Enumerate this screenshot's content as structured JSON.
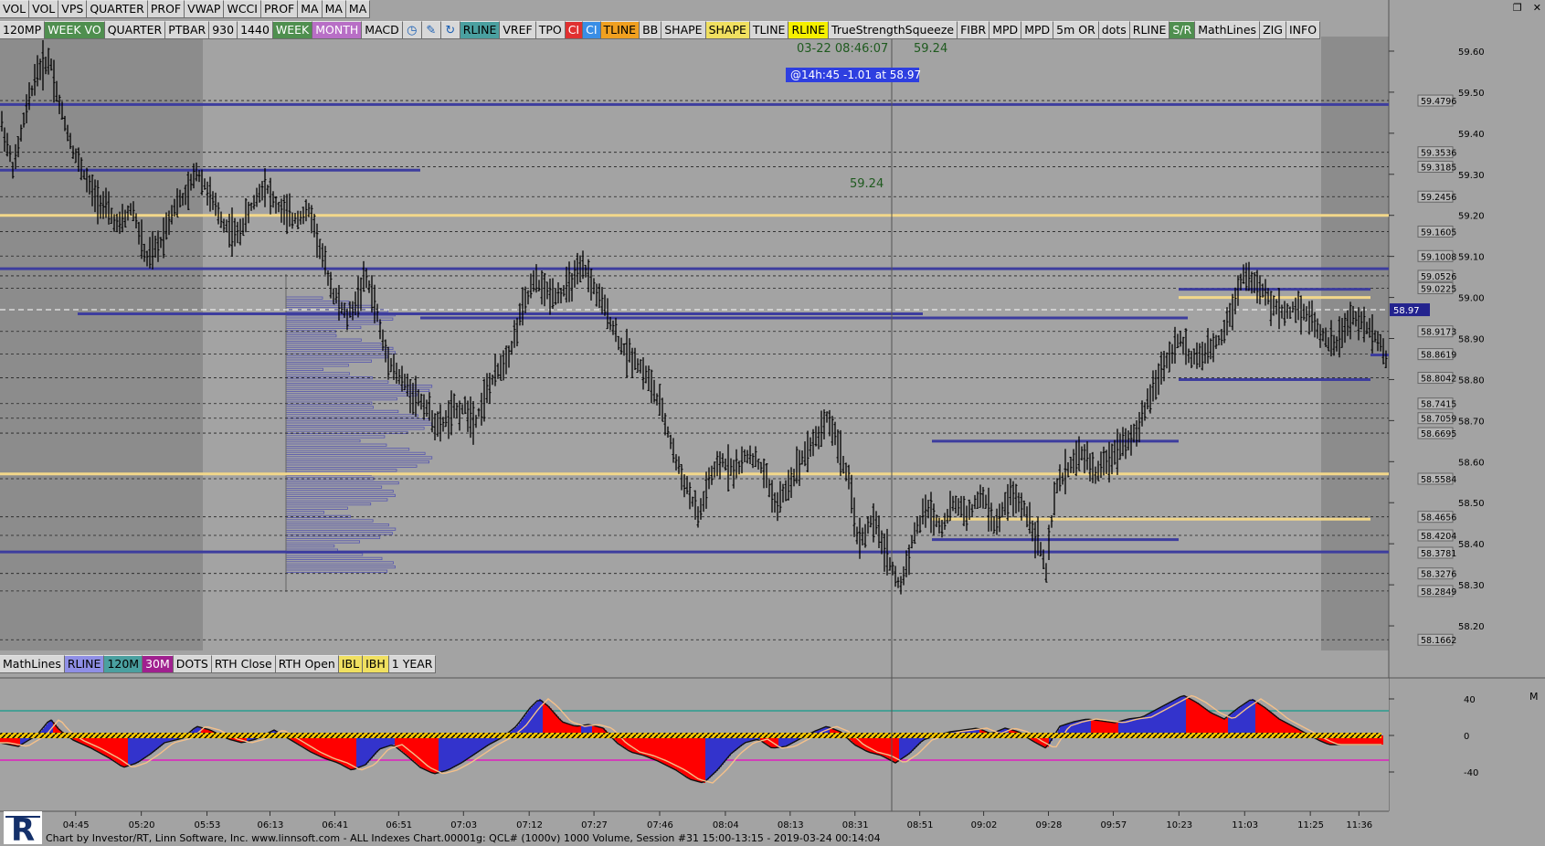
{
  "toolbar_top": [
    "VOL",
    "VOL",
    "VPS",
    "QUARTER",
    "PROF",
    "VWAP",
    "WCCI",
    "PROF",
    "MA",
    "MA",
    "MA"
  ],
  "toolbar_second": [
    {
      "label": "120MP",
      "color": "#d8d8d8"
    },
    {
      "label": "WEEK VO",
      "color": "#4f8f4f"
    },
    {
      "label": "QUARTER",
      "color": "#d8d8d8"
    },
    {
      "label": "PTBAR",
      "color": "#d8d8d8"
    },
    {
      "label": "930",
      "color": "#d8d8d8"
    },
    {
      "label": "1440",
      "color": "#d8d8d8"
    },
    {
      "label": "WEEK",
      "color": "#4f8f4f"
    },
    {
      "label": "MONTH",
      "color": "#b86fc6"
    },
    {
      "label": "MACD",
      "color": "#d8d8d8"
    },
    {
      "label": "clock-icon",
      "icon": true
    },
    {
      "label": "pencil-icon",
      "icon": true
    },
    {
      "label": "refresh-icon",
      "icon": true
    },
    {
      "label": "RLINE",
      "color": "#4aa0a0"
    },
    {
      "label": "VREF",
      "color": "#d8d8d8"
    },
    {
      "label": "TPO",
      "color": "#d8d8d8"
    },
    {
      "label": "CI",
      "color": "#e03030"
    },
    {
      "label": "CI",
      "color": "#3a8ee6"
    },
    {
      "label": "TLINE",
      "color": "#f0a020"
    },
    {
      "label": "BB",
      "color": "#d8d8d8"
    },
    {
      "label": "SHAPE",
      "color": "#d8d8d8"
    },
    {
      "label": "SHAPE",
      "color": "#f0e060"
    },
    {
      "label": "TLINE",
      "color": "#d8d8d8"
    },
    {
      "label": "RLINE",
      "color": "#f5f000"
    },
    {
      "label": "TrueStrengthSqueeze",
      "color": "#d8d8d8"
    },
    {
      "label": "FIBR",
      "color": "#d8d8d8"
    },
    {
      "label": "MPD",
      "color": "#d8d8d8"
    },
    {
      "label": "MPD",
      "color": "#d8d8d8"
    },
    {
      "label": "5m OR",
      "color": "#d8d8d8"
    },
    {
      "label": "dots",
      "color": "#d8d8d8"
    },
    {
      "label": "RLINE",
      "color": "#d8d8d8"
    },
    {
      "label": "S/R",
      "color": "#4f8f4f"
    },
    {
      "label": "MathLines",
      "color": "#d8d8d8"
    },
    {
      "label": "ZIG",
      "color": "#d8d8d8"
    },
    {
      "label": "INFO",
      "color": "#d8d8d8"
    }
  ],
  "toolbar_bottom": [
    {
      "label": "MathLines",
      "color": "#d8d8d8"
    },
    {
      "label": "RLINE",
      "color": "#8f8fe6"
    },
    {
      "label": "120M",
      "color": "#4aa0a0"
    },
    {
      "label": "30M",
      "color": "#a0208f"
    },
    {
      "label": "DOTS",
      "color": "#d8d8d8"
    },
    {
      "label": "RTH Close",
      "color": "#d8d8d8"
    },
    {
      "label": "RTH Open",
      "color": "#d8d8d8"
    },
    {
      "label": "IBL",
      "color": "#f0e060"
    },
    {
      "label": "IBH",
      "color": "#f0e060"
    },
    {
      "label": "1 YEAR",
      "color": "#d8d8d8"
    }
  ],
  "header": {
    "datetime": "03-22 08:46:07",
    "price": "59.24",
    "badge": "@14h:45  -1.01 at 58.97",
    "mid_label": "59.24"
  },
  "footer": "Chart by Investor/RT, Linn Software, Inc. www.linnsoft.com - ALL Indexes Chart.00001g: QCL# (1000v) 1000 Volume, Session #31 15:00-13:15 - 2019-03-24 00:14:04",
  "colors": {
    "bg": "#a3a3a3",
    "shade": "#8c8c8c",
    "bar": "#000000",
    "level_blue": "#3d3d9e",
    "level_yellow": "#f2d78a",
    "osc_red": "#ff0000",
    "osc_blue": "#3333cc",
    "osc_teal": "#2a9d8f",
    "osc_magenta": "#e020c0",
    "last_price": "#23238e"
  },
  "chart_data": {
    "type": "ohlc",
    "title": "",
    "ylim": [
      58.14,
      59.64
    ],
    "y_ticks": [
      59.6,
      59.5,
      59.4,
      59.3,
      59.2,
      59.1,
      59.0,
      58.9,
      58.8,
      58.7,
      58.6,
      58.5,
      58.4,
      58.3,
      58.2
    ],
    "x_ticks": [
      "04:45",
      "05:20",
      "05:53",
      "06:13",
      "06:41",
      "06:51",
      "07:03",
      "07:12",
      "07:27",
      "07:46",
      "08:04",
      "08:13",
      "08:31",
      "08:51",
      "09:02",
      "09:28",
      "09:57",
      "10:23",
      "11:03",
      "11:25",
      "11:36"
    ],
    "price_path": [
      [
        0,
        59.44
      ],
      [
        15,
        59.31
      ],
      [
        25,
        59.42
      ],
      [
        40,
        59.55
      ],
      [
        55,
        59.58
      ],
      [
        65,
        59.47
      ],
      [
        80,
        59.36
      ],
      [
        100,
        59.26
      ],
      [
        115,
        59.22
      ],
      [
        130,
        59.17
      ],
      [
        145,
        59.22
      ],
      [
        160,
        59.09
      ],
      [
        175,
        59.13
      ],
      [
        190,
        59.22
      ],
      [
        205,
        59.25
      ],
      [
        215,
        59.31
      ],
      [
        225,
        59.27
      ],
      [
        235,
        59.22
      ],
      [
        245,
        59.18
      ],
      [
        260,
        59.15
      ],
      [
        275,
        59.22
      ],
      [
        290,
        59.28
      ],
      [
        300,
        59.23
      ],
      [
        320,
        59.19
      ],
      [
        340,
        59.21
      ],
      [
        350,
        59.12
      ],
      [
        365,
        59.01
      ],
      [
        380,
        58.95
      ],
      [
        390,
        58.99
      ],
      [
        400,
        59.05
      ],
      [
        410,
        58.99
      ],
      [
        420,
        58.88
      ],
      [
        435,
        58.81
      ],
      [
        450,
        58.77
      ],
      [
        465,
        58.74
      ],
      [
        480,
        58.68
      ],
      [
        495,
        58.72
      ],
      [
        510,
        58.73
      ],
      [
        520,
        58.7
      ],
      [
        535,
        58.78
      ],
      [
        550,
        58.84
      ],
      [
        560,
        58.88
      ],
      [
        570,
        58.96
      ],
      [
        585,
        59.04
      ],
      [
        600,
        59.01
      ],
      [
        615,
        59.01
      ],
      [
        630,
        59.05
      ],
      [
        640,
        59.07
      ],
      [
        655,
        59.0
      ],
      [
        665,
        58.96
      ],
      [
        680,
        58.88
      ],
      [
        695,
        58.85
      ],
      [
        710,
        58.8
      ],
      [
        725,
        58.72
      ],
      [
        740,
        58.6
      ],
      [
        755,
        58.52
      ],
      [
        765,
        58.46
      ],
      [
        775,
        58.55
      ],
      [
        790,
        58.6
      ],
      [
        805,
        58.58
      ],
      [
        820,
        58.62
      ],
      [
        835,
        58.58
      ],
      [
        850,
        58.49
      ],
      [
        865,
        58.55
      ],
      [
        880,
        58.62
      ],
      [
        895,
        58.66
      ],
      [
        905,
        58.71
      ],
      [
        915,
        58.66
      ],
      [
        930,
        58.54
      ],
      [
        940,
        58.4
      ],
      [
        955,
        58.46
      ],
      [
        970,
        58.38
      ],
      [
        985,
        58.29
      ],
      [
        1000,
        58.42
      ],
      [
        1015,
        58.49
      ],
      [
        1030,
        58.44
      ],
      [
        1045,
        58.5
      ],
      [
        1060,
        58.47
      ],
      [
        1075,
        58.52
      ],
      [
        1090,
        58.44
      ],
      [
        1105,
        58.52
      ],
      [
        1120,
        58.49
      ],
      [
        1135,
        58.42
      ],
      [
        1145,
        58.33
      ],
      [
        1155,
        58.53
      ],
      [
        1170,
        58.59
      ],
      [
        1185,
        58.62
      ],
      [
        1200,
        58.57
      ],
      [
        1215,
        58.61
      ],
      [
        1230,
        58.65
      ],
      [
        1245,
        58.67
      ],
      [
        1260,
        58.77
      ],
      [
        1275,
        58.84
      ],
      [
        1290,
        58.9
      ],
      [
        1305,
        58.85
      ],
      [
        1320,
        58.86
      ],
      [
        1335,
        58.9
      ],
      [
        1350,
        58.98
      ],
      [
        1360,
        59.06
      ],
      [
        1375,
        59.03
      ],
      [
        1390,
        58.99
      ],
      [
        1405,
        58.96
      ],
      [
        1420,
        58.98
      ],
      [
        1435,
        58.95
      ],
      [
        1450,
        58.9
      ],
      [
        1460,
        58.88
      ],
      [
        1470,
        58.92
      ],
      [
        1480,
        58.95
      ],
      [
        1490,
        58.94
      ],
      [
        1505,
        58.91
      ],
      [
        1515,
        58.87
      ],
      [
        1520,
        58.82
      ]
    ],
    "levels": [
      {
        "price": 59.4796,
        "label": "59.4796",
        "kind": "box"
      },
      {
        "price": 59.3536,
        "label": "59.3536",
        "kind": "box"
      },
      {
        "price": 59.3185,
        "label": "59.3185",
        "kind": "box"
      },
      {
        "price": 59.2456,
        "label": "59.2456",
        "kind": "box"
      },
      {
        "price": 59.1605,
        "label": "59.1605",
        "kind": "box"
      },
      {
        "price": 59.1008,
        "label": "59.1008",
        "kind": "box"
      },
      {
        "price": 59.0526,
        "label": "59.0526",
        "kind": "box"
      },
      {
        "price": 59.0225,
        "label": "59.0225",
        "kind": "box"
      },
      {
        "price": 58.97,
        "label": "58.97",
        "kind": "last"
      },
      {
        "price": 58.9173,
        "label": "58.9173",
        "kind": "box"
      },
      {
        "price": 58.8619,
        "label": "58.8619",
        "kind": "box"
      },
      {
        "price": 58.8042,
        "label": "58.8042",
        "kind": "box"
      },
      {
        "price": 58.7415,
        "label": "58.7415",
        "kind": "box"
      },
      {
        "price": 58.7059,
        "label": "58.7059",
        "kind": "box"
      },
      {
        "price": 58.6695,
        "label": "58.6695",
        "kind": "box"
      },
      {
        "price": 58.5584,
        "label": "58.5584",
        "kind": "box"
      },
      {
        "price": 58.4656,
        "label": "58.4656",
        "kind": "box"
      },
      {
        "price": 58.4204,
        "label": "58.4204",
        "kind": "box"
      },
      {
        "price": 58.3781,
        "label": "58.3781",
        "kind": "box"
      },
      {
        "price": 58.3276,
        "label": "58.3276",
        "kind": "box"
      },
      {
        "price": 58.2849,
        "label": "58.2849",
        "kind": "box"
      },
      {
        "price": 58.1662,
        "label": "58.1662",
        "kind": "box"
      }
    ],
    "oscillator": {
      "ylim": [
        -55,
        55
      ],
      "ticks": [
        40,
        0,
        -40
      ],
      "upper_band": 27,
      "lower_band": -27,
      "path": [
        [
          0,
          -8
        ],
        [
          20,
          -12
        ],
        [
          40,
          0
        ],
        [
          55,
          18
        ],
        [
          65,
          6
        ],
        [
          80,
          -5
        ],
        [
          100,
          -14
        ],
        [
          120,
          -25
        ],
        [
          135,
          -35
        ],
        [
          150,
          -30
        ],
        [
          165,
          -20
        ],
        [
          180,
          -8
        ],
        [
          200,
          -3
        ],
        [
          215,
          10
        ],
        [
          230,
          6
        ],
        [
          250,
          -4
        ],
        [
          265,
          -8
        ],
        [
          280,
          -4
        ],
        [
          300,
          6
        ],
        [
          320,
          -6
        ],
        [
          340,
          -18
        ],
        [
          355,
          -25
        ],
        [
          370,
          -30
        ],
        [
          385,
          -38
        ],
        [
          400,
          -32
        ],
        [
          415,
          -15
        ],
        [
          430,
          -10
        ],
        [
          445,
          -22
        ],
        [
          460,
          -35
        ],
        [
          475,
          -42
        ],
        [
          490,
          -38
        ],
        [
          505,
          -30
        ],
        [
          520,
          -20
        ],
        [
          535,
          -10
        ],
        [
          550,
          -2
        ],
        [
          565,
          10
        ],
        [
          580,
          30
        ],
        [
          590,
          40
        ],
        [
          600,
          32
        ],
        [
          615,
          15
        ],
        [
          630,
          10
        ],
        [
          645,
          12
        ],
        [
          660,
          8
        ],
        [
          675,
          -8
        ],
        [
          690,
          -18
        ],
        [
          705,
          -22
        ],
        [
          720,
          -28
        ],
        [
          740,
          -38
        ],
        [
          755,
          -48
        ],
        [
          770,
          -52
        ],
        [
          785,
          -38
        ],
        [
          800,
          -20
        ],
        [
          815,
          -8
        ],
        [
          830,
          -4
        ],
        [
          845,
          -14
        ],
        [
          860,
          -12
        ],
        [
          875,
          -4
        ],
        [
          890,
          4
        ],
        [
          905,
          10
        ],
        [
          920,
          4
        ],
        [
          935,
          -10
        ],
        [
          950,
          -18
        ],
        [
          965,
          -22
        ],
        [
          980,
          -30
        ],
        [
          995,
          -20
        ],
        [
          1010,
          -5
        ],
        [
          1025,
          0
        ],
        [
          1040,
          4
        ],
        [
          1055,
          6
        ],
        [
          1070,
          8
        ],
        [
          1085,
          2
        ],
        [
          1100,
          8
        ],
        [
          1115,
          4
        ],
        [
          1130,
          -6
        ],
        [
          1145,
          -14
        ],
        [
          1160,
          10
        ],
        [
          1175,
          15
        ],
        [
          1190,
          18
        ],
        [
          1205,
          16
        ],
        [
          1220,
          14
        ],
        [
          1235,
          18
        ],
        [
          1250,
          20
        ],
        [
          1265,
          28
        ],
        [
          1280,
          36
        ],
        [
          1295,
          44
        ],
        [
          1310,
          36
        ],
        [
          1325,
          25
        ],
        [
          1340,
          18
        ],
        [
          1355,
          30
        ],
        [
          1370,
          40
        ],
        [
          1385,
          30
        ],
        [
          1400,
          18
        ],
        [
          1415,
          10
        ],
        [
          1430,
          2
        ],
        [
          1445,
          -6
        ],
        [
          1455,
          -10
        ]
      ]
    }
  }
}
